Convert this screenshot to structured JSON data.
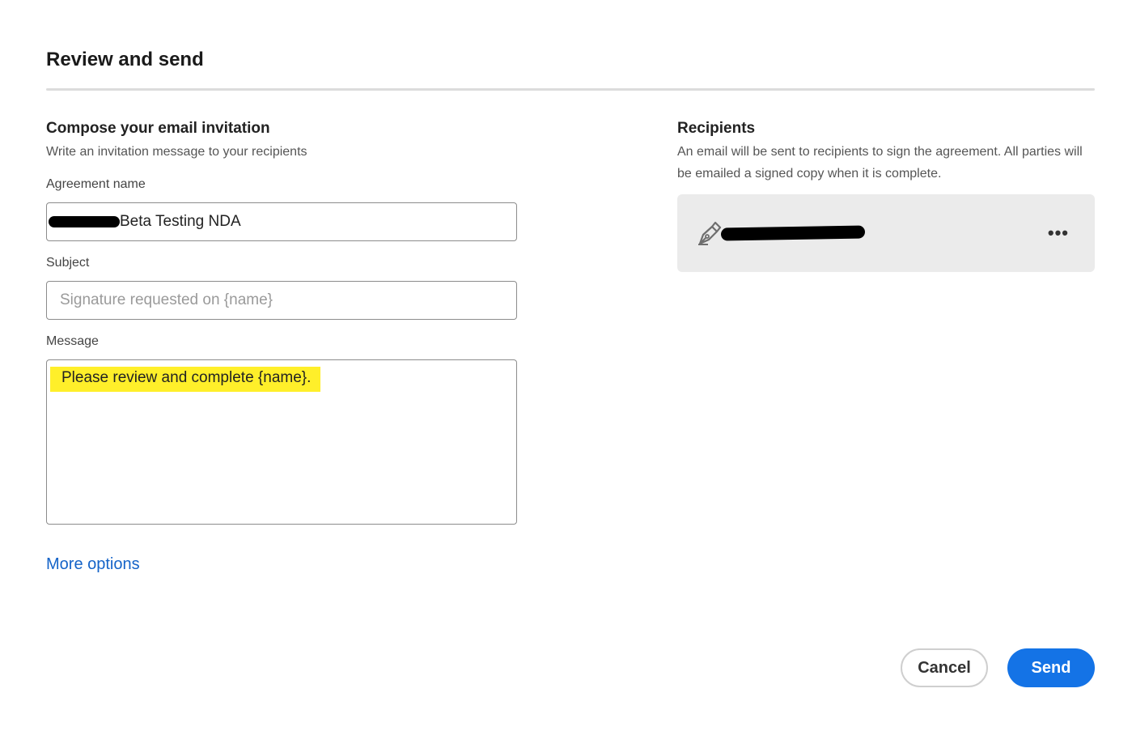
{
  "dialog": {
    "title": "Review and send"
  },
  "compose": {
    "title": "Compose your email invitation",
    "subtitle": "Write an invitation message to your recipients",
    "agreement_label": "Agreement name",
    "agreement_value": "Beta Testing NDA",
    "subject_label": "Subject",
    "subject_placeholder": "Signature requested on {name}",
    "message_label": "Message",
    "message_value": "Please review and complete {name}."
  },
  "more_options": "More options",
  "recipients": {
    "title": "Recipients",
    "description": "An email will be sent to recipients to sign the agreement. All parties will be emailed a signed copy when it is complete.",
    "items": [
      {
        "icon": "pen-icon",
        "more_label": "•••"
      }
    ]
  },
  "buttons": {
    "cancel": "Cancel",
    "send": "Send"
  },
  "colors": {
    "accent": "#1473e6",
    "link": "#1463c8",
    "highlight": "#ffef2a",
    "card_bg": "#ebebeb"
  }
}
